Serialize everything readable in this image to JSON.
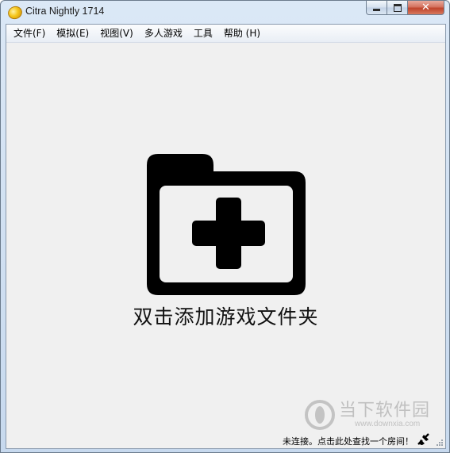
{
  "window": {
    "title": "Citra Nightly 1714",
    "controls": {
      "minimize": "minimize",
      "maximize": "maximize",
      "close": "✕"
    }
  },
  "menubar": {
    "items": [
      {
        "label": "文件(F)"
      },
      {
        "label": "模拟(E)"
      },
      {
        "label": "视图(V)"
      },
      {
        "label": "多人游戏"
      },
      {
        "label": "工具"
      },
      {
        "label": "帮助 (H)"
      }
    ]
  },
  "main": {
    "icon": "folder-add-icon",
    "label": "双击添加游戏文件夹"
  },
  "statusbar": {
    "text": "未连接。点击此处查找一个房间！",
    "icon": "network-disconnected-icon"
  },
  "watermark": {
    "text_cn": "当下软件园",
    "text_en": "www.downxia.com"
  },
  "colors": {
    "title_gradient_top": "#dbe8f6",
    "client_bg": "#f0f0f0",
    "close_red": "#c0442c",
    "icon_black": "#000000"
  }
}
